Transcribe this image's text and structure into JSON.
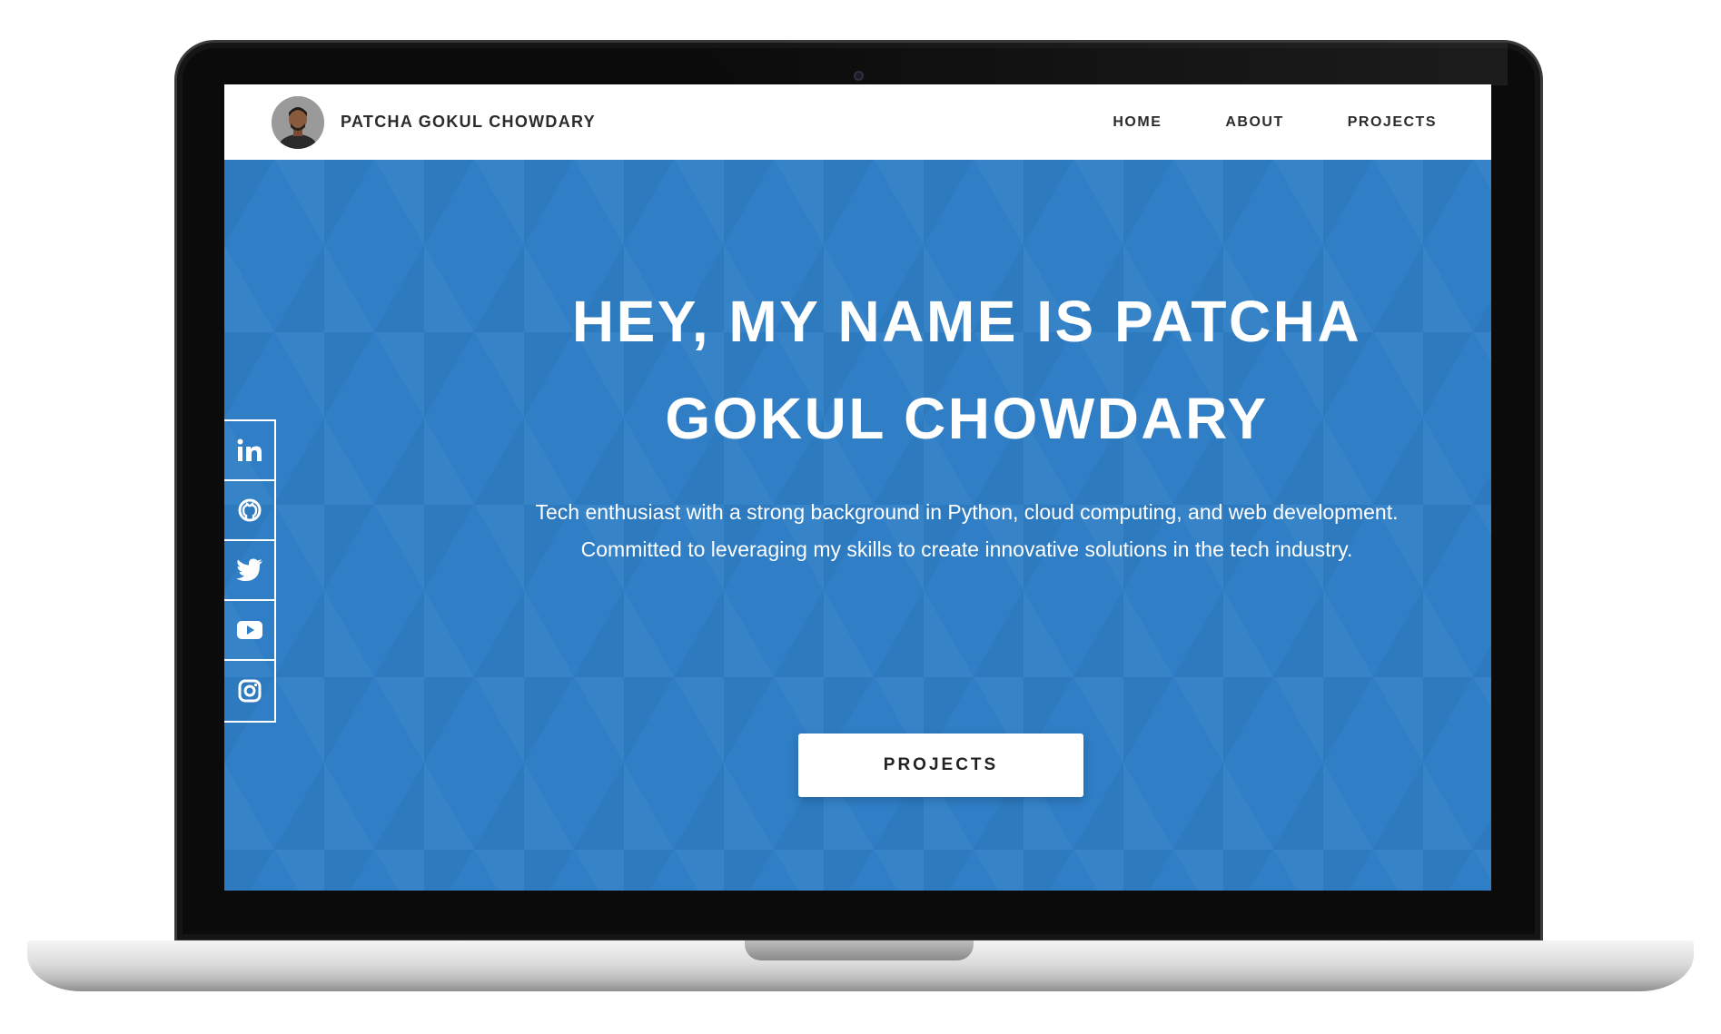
{
  "navbar": {
    "brand": "PATCHA GOKUL CHOWDARY",
    "links": [
      "HOME",
      "ABOUT",
      "PROJECTS"
    ]
  },
  "hero": {
    "title_line1": "HEY, MY NAME IS PATCHA",
    "title_line2": "GOKUL CHOWDARY",
    "description": "Tech enthusiast with a strong background in Python, cloud computing, and web development. Committed to leveraging my skills to create innovative solutions in the tech industry.",
    "button_label": "PROJECTS"
  },
  "social_links": [
    {
      "icon": "linkedin-icon"
    },
    {
      "icon": "github-icon"
    },
    {
      "icon": "twitter-icon"
    },
    {
      "icon": "youtube-icon"
    },
    {
      "icon": "instagram-icon"
    }
  ],
  "colors": {
    "hero_background": "#2f7ec6",
    "navbar_background": "#ffffff",
    "text_dark": "#2b2b2b",
    "text_light": "#ffffff"
  }
}
